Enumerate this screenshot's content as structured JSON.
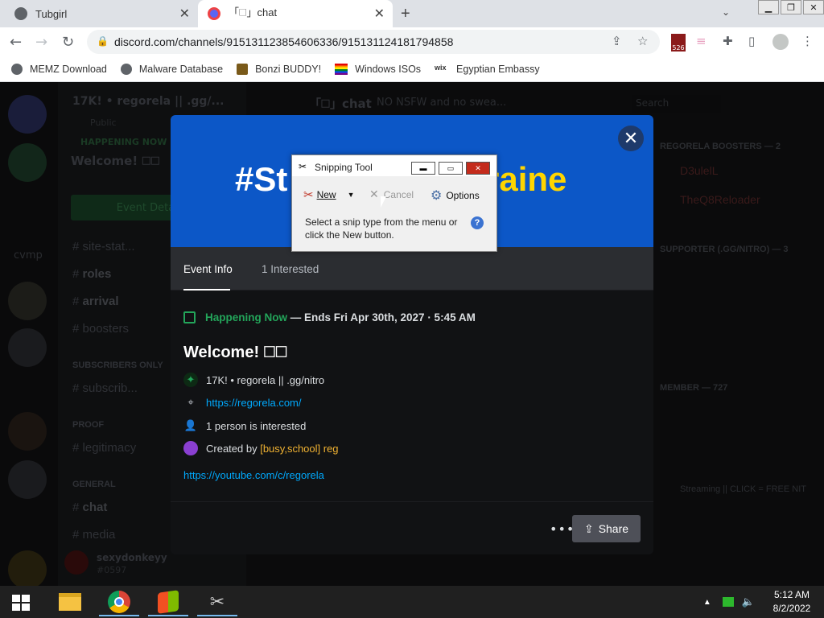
{
  "browser": {
    "tabs": [
      {
        "label": "Tubgirl",
        "active": false
      },
      {
        "label": "「🗆」chat",
        "active": true
      }
    ],
    "url": "discord.com/channels/915131123854606336/915131124181794858",
    "extension_badge": "526",
    "bookmarks": [
      "MEMZ Download",
      "Malware Database",
      "Bonzi BUDDY!",
      "Windows ISOs",
      "Egyptian Embassy"
    ]
  },
  "discord_bg": {
    "server_name": "17K! • regorela || .gg/...",
    "channel_header": "「🗆」chat",
    "header_rules": "NO NSFW and no swea...",
    "search_placeholder": "Search",
    "public_label": "Public",
    "happening_now": "HAPPENING NOW",
    "event_short": "Welcome! 🗆🗆",
    "event_details_btn": "Event Details",
    "side_label": "cvmp",
    "channels": [
      {
        "name": "site-stat..."
      },
      {
        "name": "roles"
      },
      {
        "name": "arrival"
      },
      {
        "name": "boosters"
      },
      {
        "name": "SUBSCRIBERS ONLY"
      },
      {
        "name": "subscrib..."
      },
      {
        "name": "PROOF"
      },
      {
        "name": "legitimacy"
      },
      {
        "name": "GENERAL"
      },
      {
        "name": "chat"
      },
      {
        "name": "media"
      }
    ],
    "user_name": "sexydonkeyy",
    "user_tag": "#0597",
    "members": [
      "REGORELA BOOSTERS — 2",
      "D3ulelL",
      "TheQ8Reloader",
      "SUPPORTER (.GG/NITRO) — 3",
      "MEMBER — 727",
      "Streaming || CLICK = FREE NIT"
    ]
  },
  "event": {
    "banner_left": "#St",
    "banner_right": "raine",
    "tabs": [
      "Event Info",
      "1 Interested"
    ],
    "status": "Happening Now",
    "ends": "— Ends Fri Apr 30th, 2027 · 5:45 AM",
    "title": "Welcome! 🗆🗆",
    "server": "17K! • regorela || .gg/nitro",
    "location": "https://regorela.com/",
    "interested": "1 person is interested",
    "created_prefix": "Created by",
    "creator": "[busy,school] reg",
    "description_link": "https://youtube.com/c/regorela",
    "share_label": "Share",
    "more_label": "•••"
  },
  "snipping_tool": {
    "title": "Snipping Tool",
    "new_label": "New",
    "cancel_label": "Cancel",
    "options_label": "Options",
    "message": "Select a snip type from the menu or click the New button.",
    "help": "?"
  },
  "taskbar": {
    "time": "5:12 AM",
    "date": "8/2/2022"
  },
  "colors": {
    "discord_green": "#23a55a",
    "discord_link": "#00a8fc",
    "banner_blue": "#0c57c7",
    "banner_yellow": "#ffd500"
  }
}
